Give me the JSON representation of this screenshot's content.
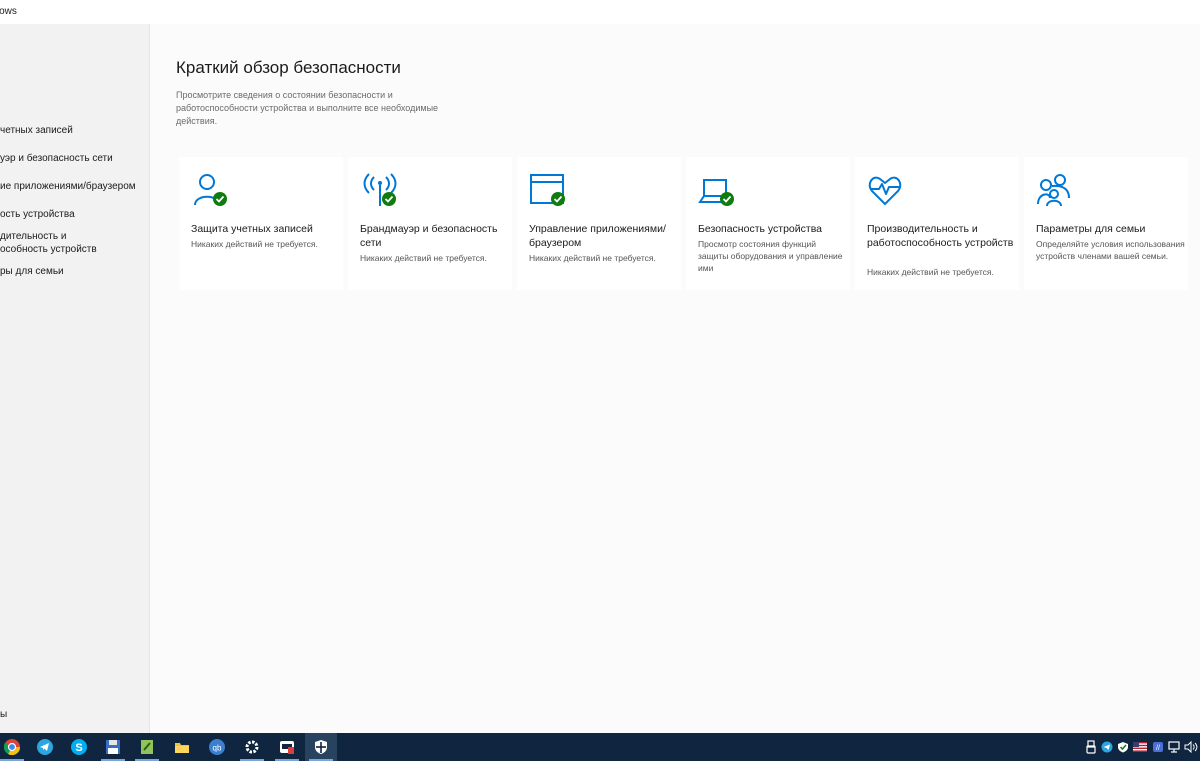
{
  "window": {
    "title": "ndows"
  },
  "sidebar": {
    "items": [
      {
        "label": "четных записей"
      },
      {
        "label": "уэр и безопасность сети"
      },
      {
        "label": "ие приложениями/браузером"
      },
      {
        "label": "ость устройства"
      },
      {
        "label": "дительность и",
        "label2": "особность устройств"
      },
      {
        "label": "ры для семьи"
      }
    ],
    "footer_label": "ы"
  },
  "main": {
    "title": "Краткий обзор безопасности",
    "description": "Просмотрите сведения о состоянии безопасности и работоспособности устройства и выполните все необходимые действия.",
    "cards": [
      {
        "title": "Защита учетных записей",
        "desc": "Никаких действий не требуется.",
        "icon": "account-protection-icon"
      },
      {
        "title": "Брандмауэр и безопасность сети",
        "desc": "Никаких действий не требуется.",
        "icon": "firewall-antenna-icon"
      },
      {
        "title": "Управление приложениями/браузером",
        "desc": "Никаких действий не требуется.",
        "icon": "app-browser-window-icon"
      },
      {
        "title": "Безопасность устройства",
        "desc": "Просмотр состояния функций защиты оборудования и управление ими",
        "icon": "laptop-icon"
      },
      {
        "title": "Производительность и работоспособность устройств",
        "desc": "Никаких действий не требуется.",
        "icon": "heart-pulse-icon"
      },
      {
        "title": "Параметры для семьи",
        "desc": "Определяйте условия использования устройств членами вашей семьи.",
        "icon": "family-icon"
      }
    ]
  },
  "taskbar": {
    "apps": [
      "chrome-icon",
      "telegram-icon",
      "skype-icon",
      "floppy-disk-icon",
      "notepad-plus-icon",
      "file-explorer-icon",
      "qbittorrent-icon",
      "settings-gear-icon",
      "store-icon",
      "windows-security-shield-icon"
    ]
  },
  "colors": {
    "accent": "#0078d7",
    "ok": "#107c10",
    "taskbar": "#0f2540"
  }
}
